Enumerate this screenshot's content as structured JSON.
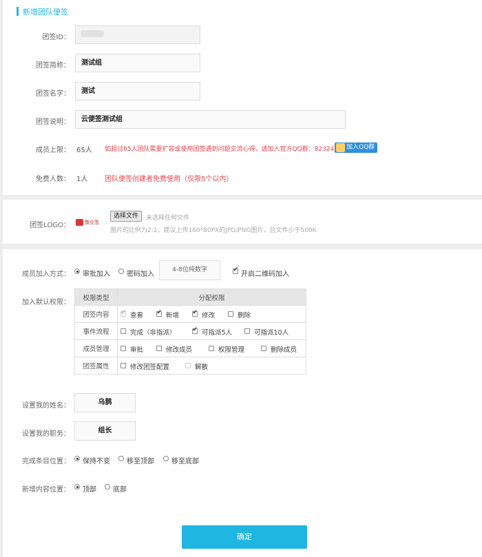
{
  "header": {
    "title": "新增团队便签"
  },
  "basic": {
    "id_label": "团签ID：",
    "id_value": "",
    "short_name_label": "团签简称：",
    "short_name_value": "测试组",
    "name_label": "团签名字：",
    "name_value": "测试",
    "desc_label": "团签说明：",
    "desc_value": "云便签测试组",
    "member_limit_label": "成员上限：",
    "member_limit_value": "65人",
    "member_limit_warning": "如超过65人团队需要扩容或使用团签遇到问题交流心得，请加入官方QQ群：823241772",
    "qq_button": "加入QQ群",
    "free_label": "免费人数：",
    "free_value": "1人",
    "free_note": "团队便签创建者免费使用（仅限5个以内）"
  },
  "logo": {
    "label": "团签LOGO：",
    "brand_text": "敬业签",
    "choose_button": "选择文件",
    "no_file": "未选择任何文件",
    "hint": "图片的比例为2:1，建议上传160*80PX的JPG/PNG图片，且文件小于500K"
  },
  "join": {
    "label": "成员加入方式：",
    "option_review": "审批加入",
    "option_password": "密码加入",
    "password_placeholder": "4-8位纯数字",
    "qr_label": "开启二维码加入",
    "review_selected": true,
    "qr_checked": true
  },
  "permissions": {
    "label": "加入默认权限：",
    "col_type": "权限类型",
    "col_assign": "分配权限",
    "rows": [
      {
        "category": "团签内容",
        "items": [
          {
            "label": "查看",
            "checked": true,
            "disabled": true
          },
          {
            "label": "新增",
            "checked": true,
            "disabled": false
          },
          {
            "label": "修改",
            "checked": true,
            "disabled": false
          },
          {
            "label": "删除",
            "checked": false,
            "disabled": false
          }
        ]
      },
      {
        "category": "事件流程",
        "items": [
          {
            "label": "完成（非指派）",
            "checked": false,
            "disabled": false
          },
          {
            "label": "可指派5人",
            "checked": true,
            "disabled": false
          },
          {
            "label": "可指派10人",
            "checked": false,
            "disabled": false
          }
        ]
      },
      {
        "category": "成员管理",
        "items": [
          {
            "label": "审批",
            "checked": false,
            "disabled": false
          },
          {
            "label": "修改成员",
            "checked": false,
            "disabled": false
          },
          {
            "label": "权限管理",
            "checked": false,
            "disabled": false
          },
          {
            "label": "删除成员",
            "checked": false,
            "disabled": false
          }
        ]
      },
      {
        "category": "团签属性",
        "items": [
          {
            "label": "修改团签配置",
            "checked": false,
            "disabled": false
          },
          {
            "label": "解散",
            "checked": false,
            "disabled": true
          }
        ]
      }
    ]
  },
  "profile": {
    "name_label": "设置我的姓名：",
    "name_value": "乌鹊",
    "title_label": "设置我的职务：",
    "title_value": "组长"
  },
  "complete_position": {
    "label": "完成条目位置：",
    "options": [
      "保持不变",
      "移至顶部",
      "移至底部"
    ],
    "selected": 0
  },
  "new_position": {
    "label": "新增内容位置：",
    "options": [
      "顶部",
      "底部"
    ],
    "selected": 0
  },
  "submit": {
    "label": "确定"
  }
}
